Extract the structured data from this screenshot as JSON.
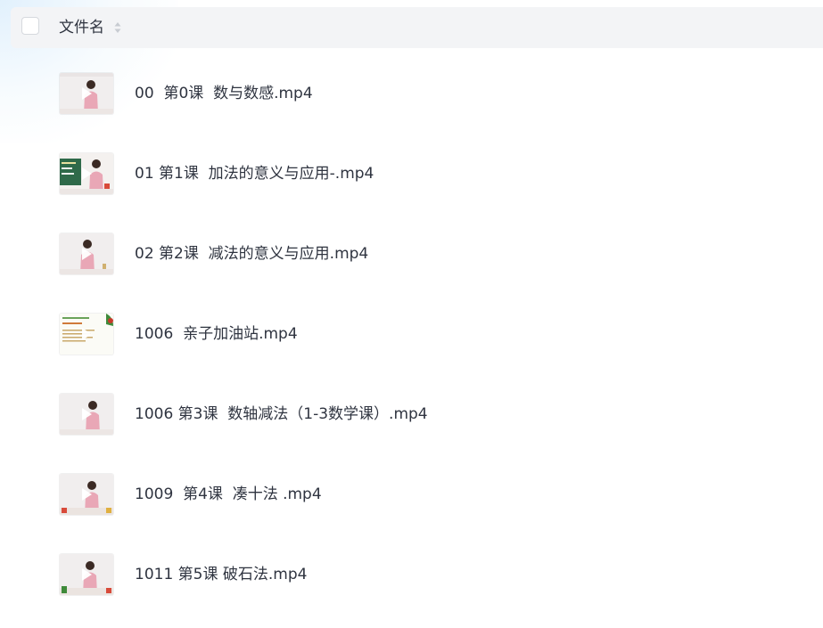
{
  "header": {
    "column_label": "文件名"
  },
  "files": [
    {
      "name": "00  第0课  数与数感.mp4",
      "thumb": "teacher"
    },
    {
      "name": "01 第1课  加法的意义与应用-.mp4",
      "thumb": "chalkboard"
    },
    {
      "name": "02 第2课  减法的意义与应用.mp4",
      "thumb": "teacher"
    },
    {
      "name": "1006  亲子加油站.mp4",
      "thumb": "slide"
    },
    {
      "name": "1006 第3课  数轴减法（1-3数学课）.mp4",
      "thumb": "teacher"
    },
    {
      "name": "1009  第4课  凑十法 .mp4",
      "thumb": "teacher"
    },
    {
      "name": "1011 第5课 破石法.mp4",
      "thumb": "teacher"
    }
  ]
}
